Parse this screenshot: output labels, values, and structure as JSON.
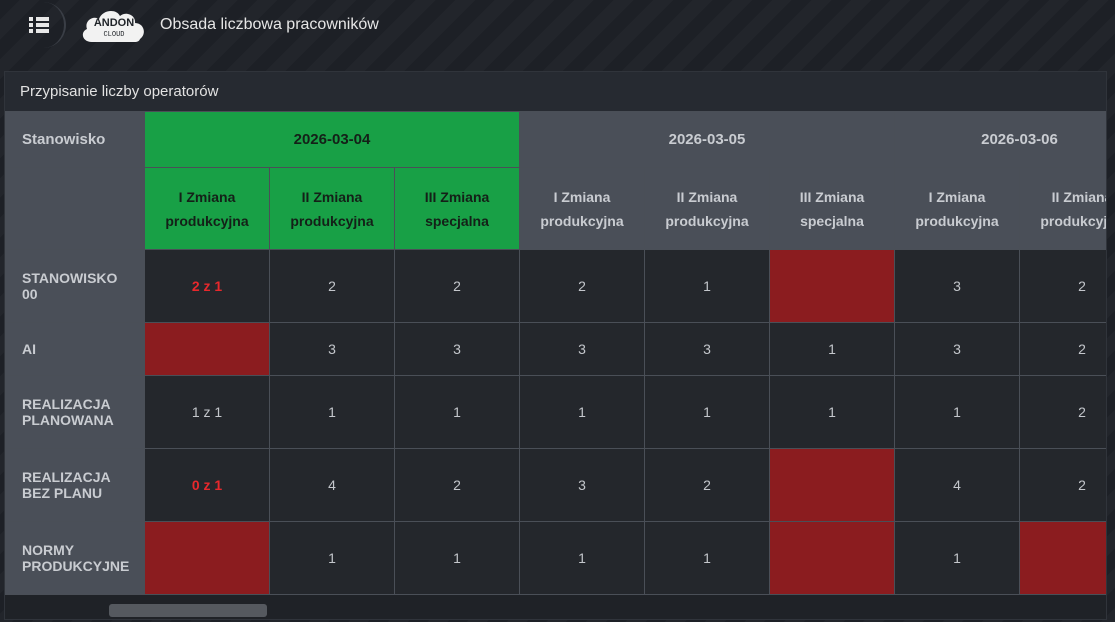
{
  "app": {
    "title": "Obsada liczbowa pracowników",
    "logo_line1": "ANDON",
    "logo_line2": "CLOUD"
  },
  "panel": {
    "title": "Przypisanie liczby operatorów"
  },
  "table": {
    "corner_label": "Stanowisko",
    "dates": [
      {
        "label": "2026-03-04",
        "active": true
      },
      {
        "label": "2026-03-05",
        "active": false
      },
      {
        "label": "2026-03-06",
        "active": false
      }
    ],
    "shifts": [
      {
        "line1": "I Zmiana",
        "line2": "produkcyjna"
      },
      {
        "line1": "II Zmiana",
        "line2": "produkcyjna"
      },
      {
        "line1": "III Zmiana",
        "line2": "specjalna"
      },
      {
        "line1": "I Zmiana",
        "line2": "produkcyjna"
      },
      {
        "line1": "II Zmiana",
        "line2": "produkcyjna"
      },
      {
        "line1": "III Zmiana",
        "line2": "specjalna"
      },
      {
        "line1": "I Zmiana",
        "line2": "produkcyjna"
      },
      {
        "line1": "II Zmiana",
        "line2": "produkcyjna"
      }
    ],
    "rows": [
      {
        "line1": "STANOWISKO",
        "line2": "00",
        "cells": [
          "2 z 1",
          "2",
          "2",
          "2",
          "1",
          "",
          "3",
          "2"
        ]
      },
      {
        "line1": "AI",
        "line2": "",
        "cells": [
          "",
          "3",
          "3",
          "3",
          "3",
          "1",
          "3",
          "2"
        ]
      },
      {
        "line1": "REALIZACJA",
        "line2": "PLANOWANA",
        "cells": [
          "1 z 1",
          "1",
          "1",
          "1",
          "1",
          "1",
          "1",
          "2"
        ]
      },
      {
        "line1": "REALIZACJA",
        "line2": "BEZ PLANU",
        "cells": [
          "0 z 1",
          "4",
          "2",
          "3",
          "2",
          "",
          "4",
          "2"
        ]
      },
      {
        "line1": "NORMY",
        "line2": "PRODUKCYJNE",
        "cells": [
          "",
          "1",
          "1",
          "1",
          "1",
          "",
          "1",
          ""
        ]
      }
    ]
  },
  "colors": {
    "active_header": "#18a046",
    "empty_cell": "#8b1c1f",
    "warning_text": "#e8282c"
  }
}
